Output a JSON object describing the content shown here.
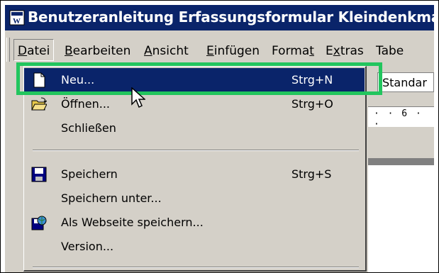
{
  "window": {
    "title": "Benutzeranleitung Erfassungsformular Kleindenkmal"
  },
  "menubar": {
    "items": [
      {
        "id": "datei",
        "label": "Datei"
      },
      {
        "id": "bearbeiten",
        "label": "Bearbeiten"
      },
      {
        "id": "ansicht",
        "label": "Ansicht"
      },
      {
        "id": "einfuegen",
        "label": "Einfügen"
      },
      {
        "id": "format",
        "label": "Format"
      },
      {
        "id": "extras",
        "label": "Extras"
      },
      {
        "id": "tabelle",
        "label": "Tabe"
      }
    ],
    "open_item": "Datei"
  },
  "toolbar": {
    "style_value": "Standar"
  },
  "ruler": {
    "text": "· · 6 · ·"
  },
  "file_menu": {
    "items": [
      {
        "label": "Neu...",
        "shortcut": "Strg+N",
        "icon": "new-document-icon",
        "selected": true
      },
      {
        "label": "Öffnen...",
        "shortcut": "Strg+O",
        "icon": "open-folder-icon"
      },
      {
        "label": "Schließen",
        "shortcut": "",
        "icon": ""
      },
      {
        "label": "Speichern",
        "shortcut": "Strg+S",
        "icon": "save-disk-icon"
      },
      {
        "label": "Speichern unter...",
        "shortcut": "",
        "icon": ""
      },
      {
        "label": "Als Webseite speichern...",
        "shortcut": "",
        "icon": "save-as-webpage-icon"
      },
      {
        "label": "Version...",
        "shortcut": "",
        "icon": ""
      }
    ]
  },
  "colors": {
    "highlight": "#22c55e",
    "selection": "#0a246a",
    "menu_bg": "#d4d0c8"
  }
}
